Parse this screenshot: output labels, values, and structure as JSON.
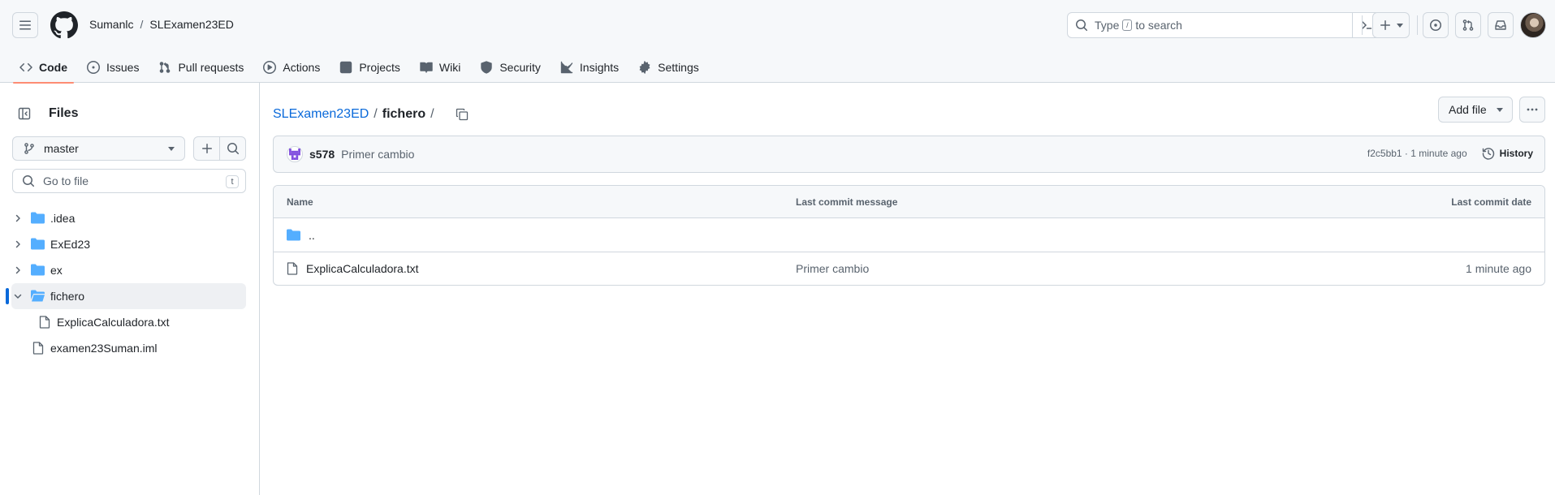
{
  "header": {
    "owner": "Sumanlc",
    "separator": "/",
    "repo": "SLExamen23ED",
    "search": {
      "prefix": "Type",
      "key": "/",
      "suffix": "to search"
    }
  },
  "tabs": [
    {
      "label": "Code",
      "icon": "code-icon",
      "active": true
    },
    {
      "label": "Issues",
      "icon": "issue-opened-icon"
    },
    {
      "label": "Pull requests",
      "icon": "git-pull-request-icon"
    },
    {
      "label": "Actions",
      "icon": "play-icon"
    },
    {
      "label": "Projects",
      "icon": "table-icon"
    },
    {
      "label": "Wiki",
      "icon": "book-icon"
    },
    {
      "label": "Security",
      "icon": "shield-icon"
    },
    {
      "label": "Insights",
      "icon": "graph-icon"
    },
    {
      "label": "Settings",
      "icon": "gear-icon"
    }
  ],
  "sidebar": {
    "title": "Files",
    "branch": "master",
    "goto_placeholder": "Go to file",
    "goto_key": "t",
    "tree": [
      {
        "label": ".idea",
        "type": "folder"
      },
      {
        "label": "ExEd23",
        "type": "folder"
      },
      {
        "label": "ex",
        "type": "folder"
      },
      {
        "label": "fichero",
        "type": "folder",
        "expanded": true,
        "selected": true
      },
      {
        "label": "ExplicaCalculadora.txt",
        "type": "file",
        "child": true
      },
      {
        "label": "examen23Suman.iml",
        "type": "file"
      }
    ]
  },
  "main": {
    "breadcrumb": {
      "repo": "SLExamen23ED",
      "sep1": "/",
      "folder": "fichero",
      "sep2": "/"
    },
    "add_file_label": "Add file",
    "commit": {
      "author": "s578",
      "message": "Primer cambio",
      "hash": "f2c5bb1",
      "dot": " · ",
      "time": "1 minute ago",
      "history_label": "History"
    },
    "table": {
      "headers": {
        "name": "Name",
        "message": "Last commit message",
        "date": "Last commit date"
      },
      "parent_label": "..",
      "rows": [
        {
          "name": "ExplicaCalculadora.txt",
          "message": "Primer cambio",
          "date": "1 minute ago"
        }
      ]
    }
  },
  "colors": {
    "accent": "#0969da",
    "active_tab_underline": "#fd8c73",
    "folder": "#54aeff",
    "border": "#d0d7de",
    "muted": "#59636e",
    "commit_avatar": "#8250df"
  }
}
